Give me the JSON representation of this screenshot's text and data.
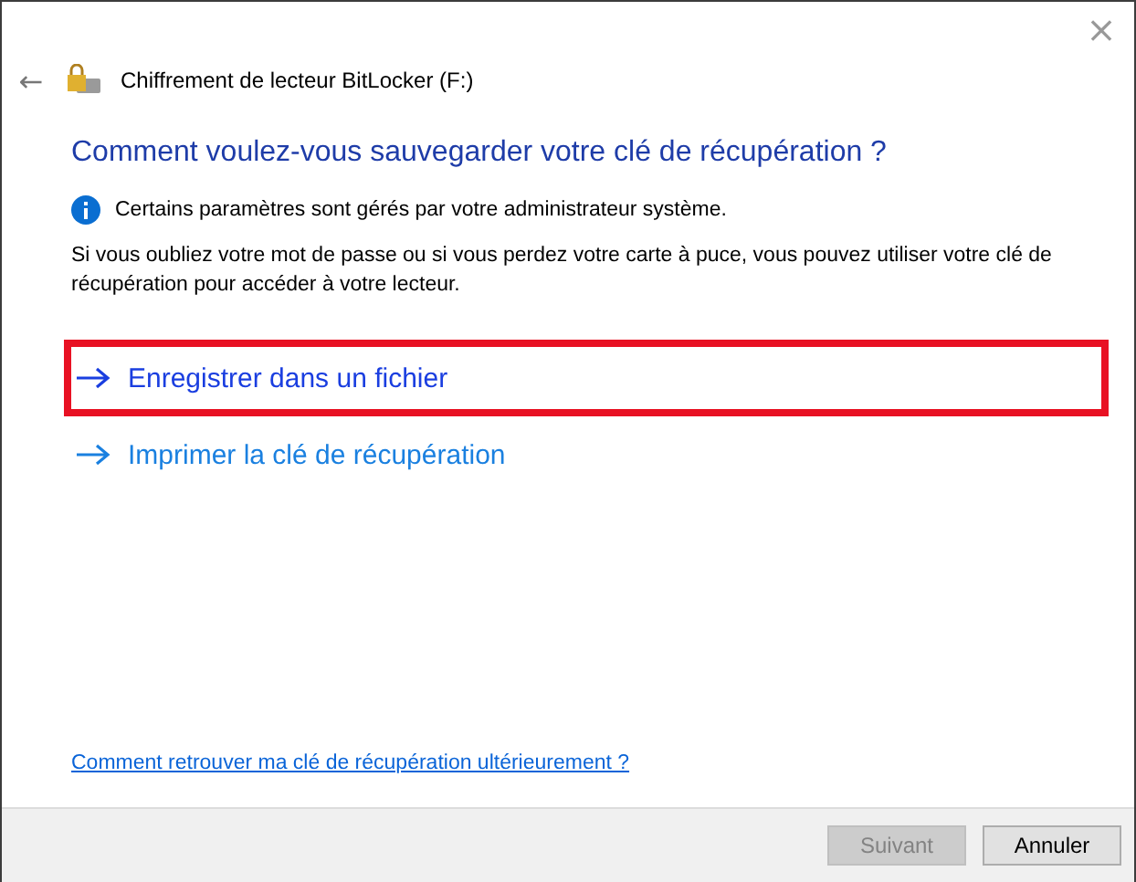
{
  "window": {
    "close": "×",
    "back": "←",
    "title": "Chiffrement de lecteur BitLocker (F:)"
  },
  "heading": "Comment voulez-vous sauvegarder votre clé de récupération ?",
  "info": "Certains paramètres sont gérés par votre administrateur système.",
  "description": "Si vous oubliez votre mot de passe ou si vous perdez votre carte à puce, vous pouvez utiliser votre clé de récupération pour accéder à votre lecteur.",
  "options": [
    {
      "label": "Enregistrer dans un fichier",
      "selected": true
    },
    {
      "label": "Imprimer la clé de récupération",
      "selected": false
    }
  ],
  "help_link": "Comment retrouver ma clé de récupération ultérieurement ?",
  "buttons": [
    {
      "label": "Suivant",
      "disabled": true
    },
    {
      "label": "Annuler",
      "disabled": false
    }
  ]
}
